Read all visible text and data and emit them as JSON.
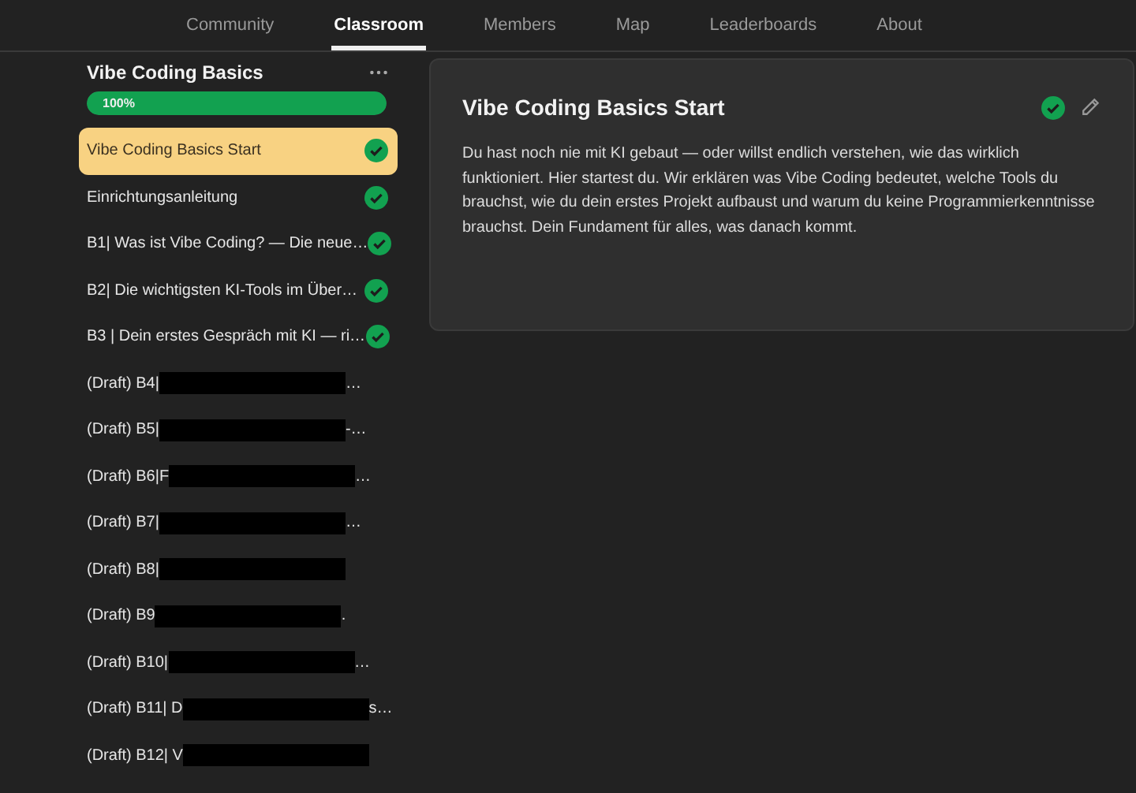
{
  "nav_tabs": [
    {
      "label": "Community",
      "selected": false
    },
    {
      "label": "Classroom",
      "selected": true
    },
    {
      "label": "Members",
      "selected": false
    },
    {
      "label": "Map",
      "selected": false
    },
    {
      "label": "Leaderboards",
      "selected": false
    },
    {
      "label": "About",
      "selected": false
    }
  ],
  "course": {
    "title": "Vibe Coding Basics",
    "progress": {
      "level": 1,
      "label": "100%"
    }
  },
  "lessons": [
    {
      "title": "Vibe Coding Basics Start",
      "selected": true,
      "completed": true,
      "redacted": false
    },
    {
      "title": "Einrichtungsanleitung",
      "selected": false,
      "completed": true,
      "redacted": false
    },
    {
      "title": "B1| Was ist Vibe Coding? — Die neue…",
      "selected": false,
      "completed": true,
      "redacted": false
    },
    {
      "title": "B2| Die wichtigsten KI-Tools im Über…",
      "selected": false,
      "completed": true,
      "redacted": false
    },
    {
      "title": "B3 | Dein erstes Gespräch mit KI — ri…",
      "selected": false,
      "completed": true,
      "redacted": false
    },
    {
      "title": "(Draft) B4| ",
      "suffix": "…",
      "selected": false,
      "completed": false,
      "redacted": true
    },
    {
      "title": "(Draft) B5| ",
      "suffix": "-…",
      "selected": false,
      "completed": false,
      "redacted": true
    },
    {
      "title": "(Draft) B6|F",
      "suffix": "…",
      "selected": false,
      "completed": false,
      "redacted": true
    },
    {
      "title": "(Draft) B7|",
      "suffix": "…",
      "selected": false,
      "completed": false,
      "redacted": true
    },
    {
      "title": "(Draft) B8| ",
      "selected": false,
      "completed": false,
      "redacted": true
    },
    {
      "title": "(Draft) B9",
      "suffix": ".",
      "selected": false,
      "completed": false,
      "redacted": true
    },
    {
      "title": "(Draft) B10| ",
      "suffix": "…",
      "selected": false,
      "completed": false,
      "redacted": true
    },
    {
      "title": "(Draft) B11| D",
      "suffix": "s…",
      "selected": false,
      "completed": false,
      "redacted": true
    },
    {
      "title": "(Draft) B12| V",
      "selected": false,
      "completed": false,
      "redacted": true
    }
  ],
  "lesson_detail": {
    "title": "Vibe Coding Basics Start",
    "completed": true,
    "description": "Du hast noch nie mit KI gebaut — oder willst endlich verstehen, wie das wirklich funktioniert. Hier startest du. Wir erklären was Vibe Coding bedeutet, welche Tools du brauchst, wie du dein erstes Projekt aufbaust und warum du keine Programmierkenntnisse brauchst. Dein Fundament für alles, was danach kommt."
  }
}
